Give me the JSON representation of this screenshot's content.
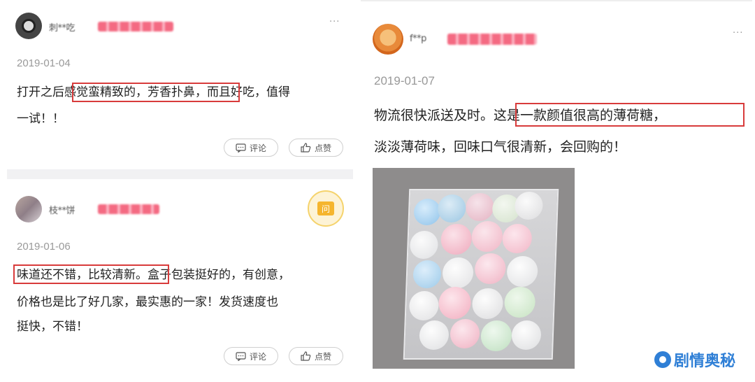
{
  "reviews": [
    {
      "user": "刺**吃",
      "date": "2019-01-04",
      "text_pre": "打开之后",
      "text_hl": "感觉蛮精致的，芳香扑鼻，",
      "text_post": "而且好吃，值得",
      "text_line2": "一试！！",
      "comment_label": "评论",
      "like_label": "点赞"
    },
    {
      "user": "枝**饼",
      "date": "2019-01-06",
      "text_hl": "味道还不错，比较清新。",
      "text_post": "盒子包装挺好的，有创意，",
      "text_line2": "价格也是比了好几家，最实惠的一家！发货速度也",
      "text_line3": "挺快，不错！",
      "ask_label": "问",
      "comment_label": "评论",
      "like_label": "点赞"
    },
    {
      "user": "f**p",
      "date": "2019-01-07",
      "text_pre": "物流很快派送及时。",
      "text_hl": "这是一款颜值很高的薄荷糖，",
      "text_line2": "淡淡薄荷味，回味口气很清新，会回购的！"
    }
  ],
  "more_icon": "···",
  "watermark": "剧情奥秘",
  "colors": {
    "highlight_border": "#d83b3b",
    "vip_badge": "#f46a82",
    "ask_badge": "#f5b52e",
    "watermark": "#2f7fd6"
  }
}
